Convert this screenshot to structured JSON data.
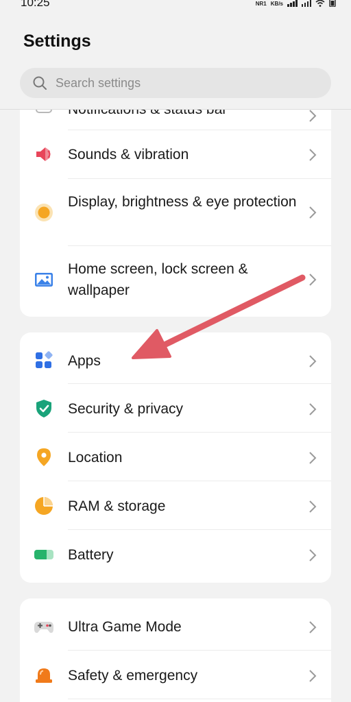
{
  "status": {
    "time": "10:25",
    "network": "NR1",
    "speed_unit": "KB/s"
  },
  "title": "Settings",
  "search": {
    "placeholder": "Search settings"
  },
  "group1": {
    "items": [
      {
        "label": "Notifications & status bar",
        "icon": "bell-icon"
      },
      {
        "label": "Sounds & vibration",
        "icon": "speaker-icon"
      },
      {
        "label": "Display, brightness & eye protection",
        "icon": "brightness-icon"
      },
      {
        "label": "Home screen, lock screen & wallpaper",
        "icon": "wallpaper-icon"
      }
    ]
  },
  "group2": {
    "items": [
      {
        "label": "Apps",
        "icon": "apps-icon"
      },
      {
        "label": "Security & privacy",
        "icon": "shield-icon"
      },
      {
        "label": "Location",
        "icon": "location-pin-icon"
      },
      {
        "label": "RAM & storage",
        "icon": "storage-pie-icon"
      },
      {
        "label": "Battery",
        "icon": "battery-icon"
      }
    ]
  },
  "group3": {
    "items": [
      {
        "label": "Ultra Game Mode",
        "icon": "gamepad-icon"
      },
      {
        "label": "Safety & emergency",
        "icon": "siren-icon"
      }
    ]
  },
  "colors": {
    "annotation_arrow": "#e05a64",
    "apps_blue": "#2f6fe4",
    "security_green": "#1aa37a",
    "location_orange": "#f5a623",
    "battery_green": "#27b36b",
    "sounds_red": "#e8455a"
  }
}
